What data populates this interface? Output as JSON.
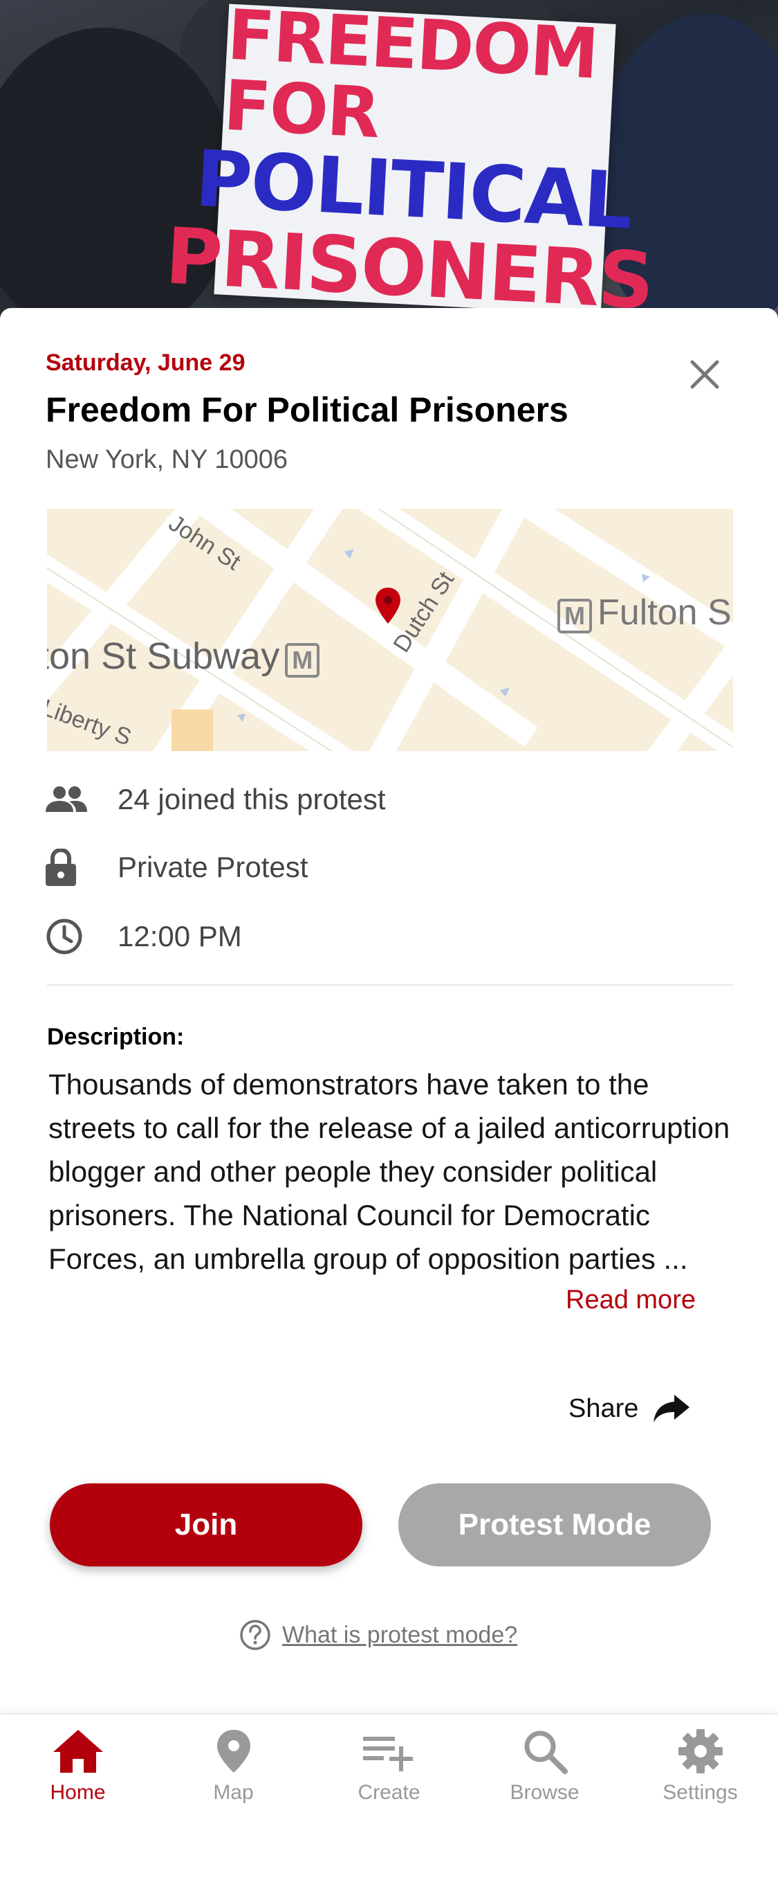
{
  "event": {
    "date": "Saturday, June 29",
    "title": "Freedom For Political Prisoners",
    "location": "New York, NY 10006"
  },
  "hero": {
    "sign_lines": [
      "FREEDOM FOR",
      "POLITICAL",
      "PRISONERS"
    ]
  },
  "map": {
    "labels": {
      "john_st": "John St",
      "dutch_st": "Dutch St",
      "subway": "ton St Subway",
      "fulton": "Fulton S",
      "liberty": "Liberty S",
      "metro_letter": "M"
    }
  },
  "info": {
    "joined": "24 joined this protest",
    "privacy": "Private Protest",
    "time": "12:00 PM"
  },
  "description": {
    "label": "Description:",
    "text": "Thousands of demonstrators have taken to the streets to call for the release of a jailed anticorruption blogger and other people they consider political prisoners. The National Council for Democratic Forces, an umbrella group of opposition parties ...",
    "read_more": "Read more"
  },
  "actions": {
    "share": "Share",
    "join": "Join",
    "protest_mode": "Protest Mode",
    "help": "What is protest mode?"
  },
  "tabs": [
    {
      "label": "Home",
      "icon": "home-icon"
    },
    {
      "label": "Map",
      "icon": "map-pin-icon"
    },
    {
      "label": "Create",
      "icon": "playlist-add-icon"
    },
    {
      "label": "Browse",
      "icon": "search-icon"
    },
    {
      "label": "Settings",
      "icon": "gear-icon"
    }
  ],
  "colors": {
    "accent": "#b3000d",
    "disabled": "#a8a8a8",
    "tab_inactive": "#999999"
  }
}
